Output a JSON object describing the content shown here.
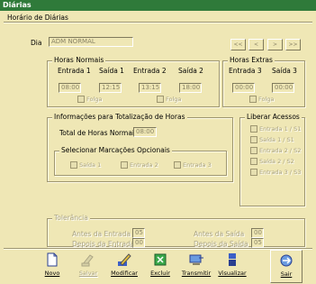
{
  "window": {
    "title": "Diárias"
  },
  "tab": {
    "label": "Horário de Diárias"
  },
  "dia": {
    "label": "Dia",
    "value": "ADM NORMAL"
  },
  "nav": {
    "first": "<<",
    "prev": "<",
    "next": ">",
    "last": ">>"
  },
  "horas_normais": {
    "title": "Horas Normais",
    "entrada1": {
      "label": "Entrada 1",
      "value": "08:00"
    },
    "saida1": {
      "label": "Saída 1",
      "value": "12:15"
    },
    "entrada2": {
      "label": "Entrada 2",
      "value": "13:15"
    },
    "saida2": {
      "label": "Saída 2",
      "value": "18:00"
    },
    "folga1": "Folga",
    "folga2": "Folga"
  },
  "horas_extras": {
    "title": "Horas Extras",
    "entrada3": {
      "label": "Entrada 3",
      "value": "00:00"
    },
    "saida3": {
      "label": "Saída 3",
      "value": "00:00"
    },
    "folga": "Folga"
  },
  "totalizacao": {
    "title": "Informações para Totalização de Horas",
    "total_label": "Total de Horas Normais",
    "total_value": "08:00",
    "opcionais": {
      "title": "Selecionar Marcações Opcionais",
      "saida1": "Saída 1",
      "entrada2": "Entrada 2",
      "entrada3": "Entrada 3"
    }
  },
  "liberar": {
    "title": "Liberar Acessos",
    "items": [
      "Entrada 1 / S1",
      "Saída 1 / S1",
      "Entrada 2 / S2",
      "Saída 2 / S2",
      "Entrada 3 / S3"
    ]
  },
  "tolerancia": {
    "title": "Tolerância",
    "antes_entrada": {
      "label": "Antes da Entrada",
      "value": "05"
    },
    "depois_entrada": {
      "label": "Depois da Entrada",
      "value": "00"
    },
    "antes_saida": {
      "label": "Antes da Saída",
      "value": "00"
    },
    "depois_saida": {
      "label": "Depois da Saída",
      "value": "05"
    }
  },
  "toolbar": {
    "novo": "Novo",
    "salvar": "Salvar",
    "modificar": "Modificar",
    "excluir": "Excluir",
    "transmitir": "Transmitir",
    "visualizar": "Visualizar",
    "sair": "Sair"
  },
  "colors": {
    "background": "#efe7b5",
    "titlebar": "#2f7a3a"
  }
}
